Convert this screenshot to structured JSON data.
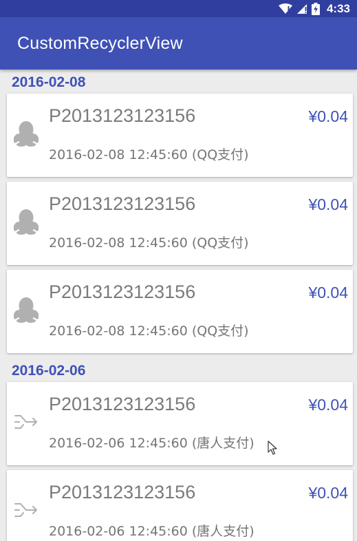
{
  "status_bar": {
    "time": "4:33",
    "icons": [
      "wifi-icon",
      "signal-icon",
      "battery-icon"
    ]
  },
  "app_bar": {
    "title": "CustomRecyclerView"
  },
  "sections": [
    {
      "date": "2016-02-08",
      "items": [
        {
          "order_no": "P2013123123156",
          "amount": "¥0.04",
          "detail": "2016-02-08 12:45:60 (QQ支付)",
          "icon": "qq-penguin-icon"
        },
        {
          "order_no": "P2013123123156",
          "amount": "¥0.04",
          "detail": "2016-02-08 12:45:60 (QQ支付)",
          "icon": "qq-penguin-icon"
        },
        {
          "order_no": "P2013123123156",
          "amount": "¥0.04",
          "detail": "2016-02-08 12:45:60 (QQ支付)",
          "icon": "qq-penguin-icon"
        }
      ]
    },
    {
      "date": "2016-02-06",
      "items": [
        {
          "order_no": "P2013123123156",
          "amount": "¥0.04",
          "detail": "2016-02-06 12:45:60 (唐人支付)",
          "icon": "transfer-arrow-icon"
        },
        {
          "order_no": "P2013123123156",
          "amount": "¥0.04",
          "detail": "2016-02-06 12:45:60 (唐人支付)",
          "icon": "transfer-arrow-icon"
        }
      ]
    }
  ],
  "colors": {
    "primary": "#3f51b5",
    "primary_dark": "#303f9f",
    "background": "#ececec",
    "card": "#ffffff",
    "text_gray": "#757575",
    "icon_gray": "#b0b0b0"
  }
}
